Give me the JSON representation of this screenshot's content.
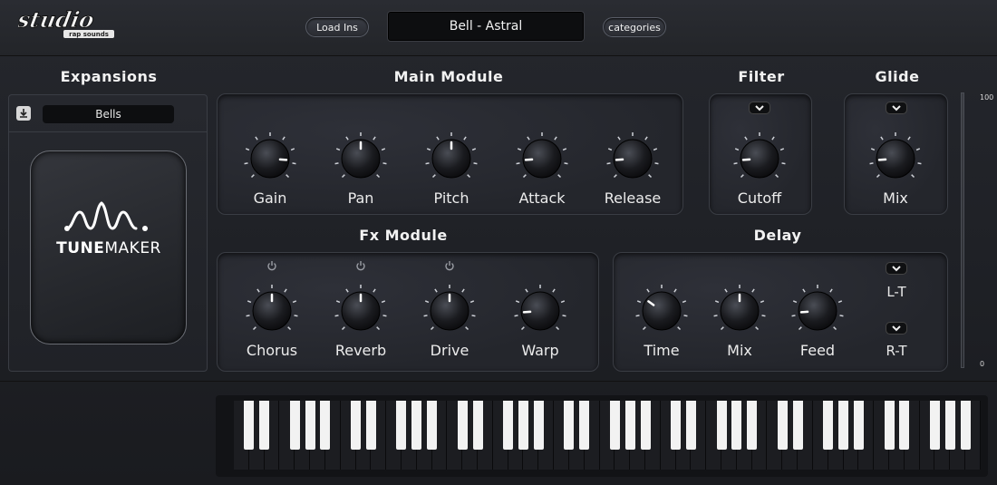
{
  "header": {
    "logo_alt": "studio rap sounds",
    "load_button": "Load Ins",
    "preset_name": "Bell - Astral",
    "categories_button": "categories"
  },
  "expansions": {
    "title": "Expansions",
    "selected": "Bells",
    "card_brand_bold": "TUNE",
    "card_brand_light": "MAKER"
  },
  "main_module": {
    "title": "Main Module",
    "knobs": [
      {
        "label": "Gain",
        "value": 0.85
      },
      {
        "label": "Pan",
        "value": 0.5
      },
      {
        "label": "Pitch",
        "value": 0.5
      },
      {
        "label": "Attack",
        "value": 0.15
      },
      {
        "label": "Release",
        "value": 0.15
      }
    ]
  },
  "filter": {
    "title": "Filter",
    "knobs": [
      {
        "label": "Cutoff",
        "value": 0.15
      }
    ]
  },
  "glide": {
    "title": "Glide",
    "knobs": [
      {
        "label": "Mix",
        "value": 0.15
      }
    ]
  },
  "fx_module": {
    "title": "Fx Module",
    "knobs": [
      {
        "label": "Chorus",
        "value": 0.5,
        "power": true
      },
      {
        "label": "Reverb",
        "value": 0.5,
        "power": true
      },
      {
        "label": "Drive",
        "value": 0.5,
        "power": true
      },
      {
        "label": "Warp",
        "value": 0.15,
        "power": false
      }
    ]
  },
  "delay": {
    "title": "Delay",
    "knobs": [
      {
        "label": "Time",
        "value": 0.3
      },
      {
        "label": "Mix",
        "value": 0.5
      },
      {
        "label": "Feed",
        "value": 0.15
      }
    ],
    "lt_label": "L-T",
    "rt_label": "R-T"
  },
  "meter": {
    "top": "100",
    "bottom": "0"
  },
  "icons": {
    "download": "download-icon",
    "chevron": "chevron-down-icon",
    "power": "power-icon"
  }
}
